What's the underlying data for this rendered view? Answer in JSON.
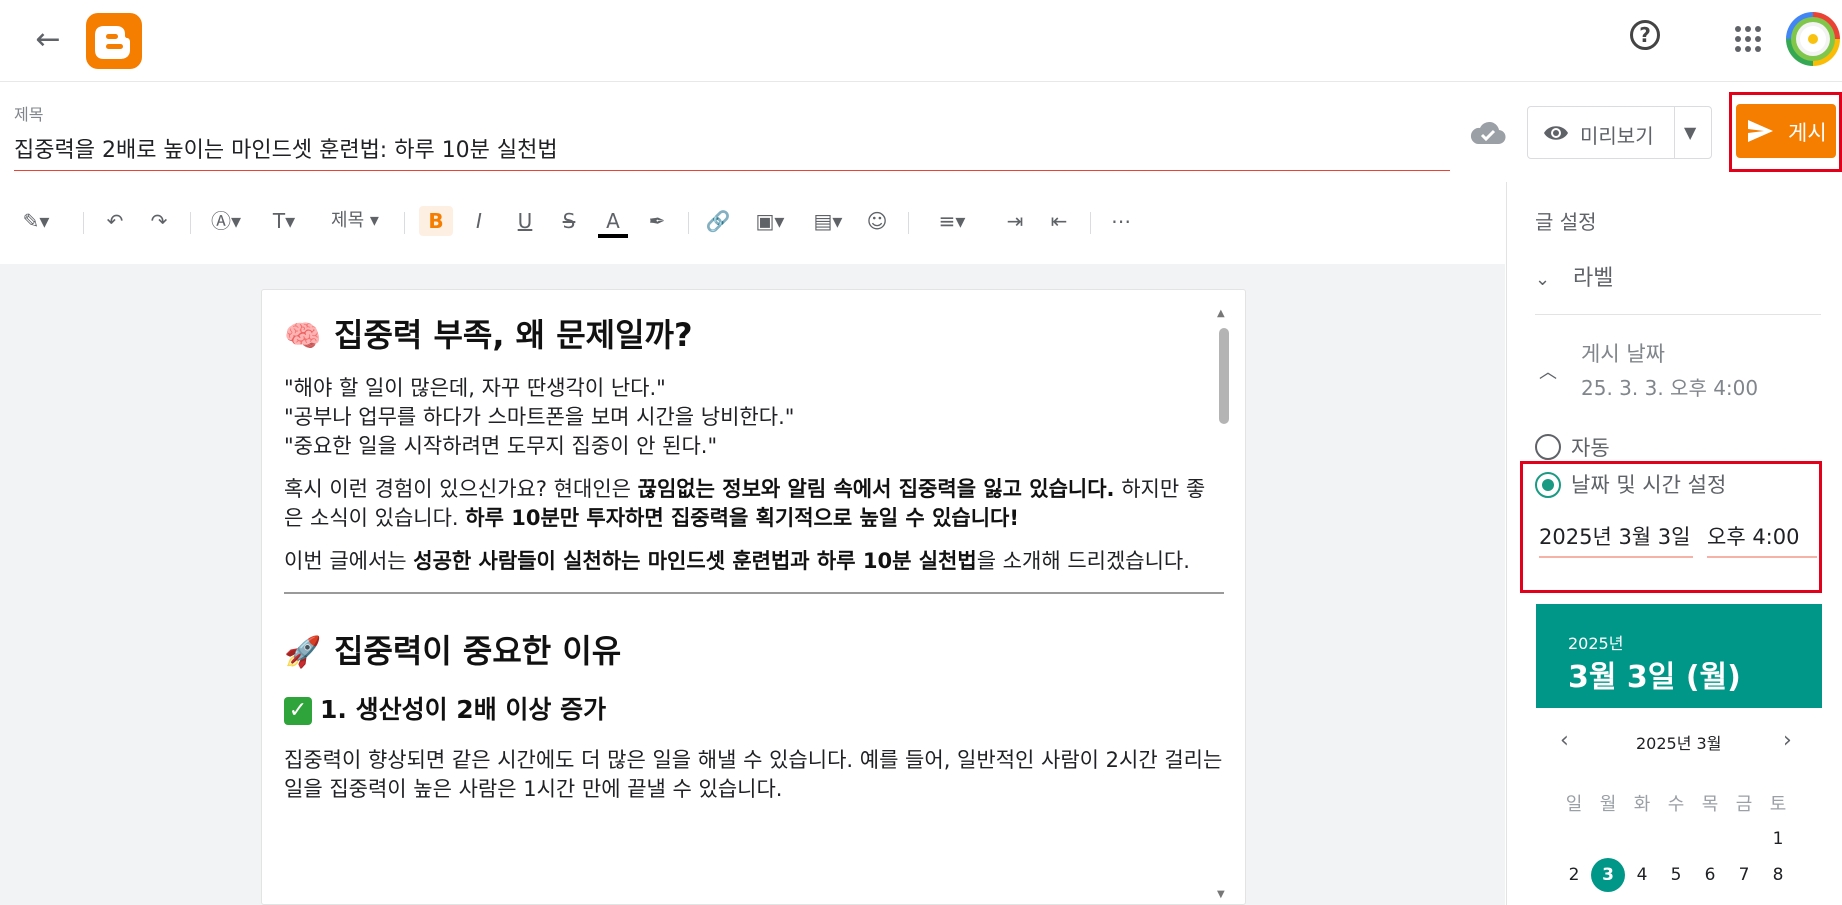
{
  "topbar": {
    "back_icon": "arrow-left-icon",
    "help_icon": "help-circle-icon",
    "apps_icon": "apps-grid-icon"
  },
  "title": {
    "label": "제목",
    "value": "집중력을 2배로 높이는 마인드셋 훈련법: 하루 10분 실천법"
  },
  "actions": {
    "preview_label": "미리보기",
    "publish_label": "게시"
  },
  "toolbar": {
    "heading_label": "제목",
    "bold": "B",
    "italic": "I",
    "underline": "U",
    "strike": "S",
    "textcolor": "A",
    "more": "⋯"
  },
  "document": {
    "h2_1": "집중력 부족, 왜 문제일까?",
    "quote1": "\"해야 할 일이 많은데, 자꾸 딴생각이 난다.\"",
    "quote2": "\"공부나 업무를 하다가 스마트폰을 보며 시간을 낭비한다.\"",
    "quote3": "\"중요한 일을 시작하려면 도무지 집중이 안 된다.\"",
    "p2_a": "혹시 이런 경험이 있으신가요? 현대인은 ",
    "p2_b": "끊임없는 정보와 알림 속에서 집중력을 잃고 있습니다.",
    "p2_c": " 하지만 좋은 소식이 있습니다. ",
    "p2_d": "하루 10분만 투자하면 집중력을 획기적으로 높일 수 있습니다!",
    "p3_a": "이번 글에서는 ",
    "p3_b": "성공한 사람들이 실천하는 마인드셋 훈련법과 하루 10분 실천법",
    "p3_c": "을 소개해 드리겠습니다.",
    "h2_2": "집중력이 중요한 이유",
    "h3_1": "1. 생산성이 2배 이상 증가",
    "p4": "집중력이 향상되면 같은 시간에도 더 많은 일을 해낼 수 있습니다. 예를 들어, 일반적인 사람이 2시간 걸리는 일을 집중력이 높은 사람은 1시간 만에 끝낼 수 있습니다."
  },
  "sidebar": {
    "title": "글 설정",
    "label_section": "라벨",
    "date_section": "게시 날짜",
    "date_summary": "25. 3. 3. 오후 4:00",
    "radio_auto": "자동",
    "radio_custom": "날짜 및 시간 설정",
    "date_input": "2025년 3월 3일",
    "time_input": "오후 4:00"
  },
  "calendar": {
    "year": "2025년",
    "selected": "3월 3일 (월)",
    "month_label": "2025년 3월",
    "dow": [
      "일",
      "월",
      "화",
      "수",
      "목",
      "금",
      "토"
    ],
    "days": [
      "1",
      "2",
      "3",
      "4",
      "5",
      "6",
      "7",
      "8"
    ],
    "selected_day": "3",
    "accent": "#009688"
  },
  "colors": {
    "brand": "#f57d00",
    "highlight_border": "#e3001b"
  }
}
